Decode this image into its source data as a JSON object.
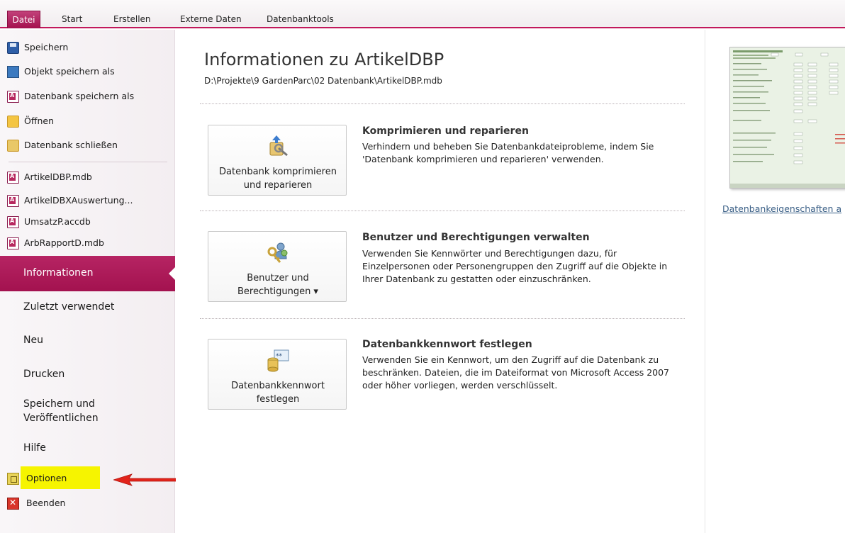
{
  "ribbon": {
    "tabs": [
      "Datei",
      "Start",
      "Erstellen",
      "Externe Daten",
      "Datenbanktools"
    ]
  },
  "backstage": {
    "quick_commands": [
      {
        "label": "Speichern",
        "icon": "save-icon"
      },
      {
        "label": "Objekt speichern als",
        "icon": "save-object-as-icon"
      },
      {
        "label": "Datenbank speichern als",
        "icon": "save-database-as-icon"
      },
      {
        "label": "Öffnen",
        "icon": "open-folder-icon"
      },
      {
        "label": "Datenbank schließen",
        "icon": "close-database-icon"
      }
    ],
    "recent_files": [
      "ArtikelDBP.mdb",
      "ArtikelDBXAuswertung...",
      "UmsatzP.accdb",
      "ArbRapportD.mdb"
    ],
    "nav": {
      "informationen": "Informationen",
      "zuletzt": "Zuletzt verwendet",
      "neu": "Neu",
      "drucken": "Drucken",
      "speichern_line1": "Speichern und",
      "speichern_line2": "Veröffentlichen",
      "hilfe": "Hilfe"
    },
    "bottom_commands": {
      "optionen": "Optionen",
      "beenden": "Beenden"
    }
  },
  "info": {
    "title": "Informationen zu ArtikelDBP",
    "path": "D:\\Projekte\\9 GardenParc\\02 Datenbank\\ArtikelDBP.mdb",
    "sections": [
      {
        "button_line1": "Datenbank komprimieren",
        "button_line2": "und reparieren",
        "heading": "Komprimieren und reparieren",
        "description": "Verhindern und beheben Sie Datenbankdateiprobleme, indem Sie 'Datenbank komprimieren und reparieren' verwenden."
      },
      {
        "button_line1": "Benutzer und",
        "button_line2": "Berechtigungen ▾",
        "heading": "Benutzer und Berechtigungen verwalten",
        "description": "Verwenden Sie Kennwörter und Berechtigungen dazu, für Einzelpersonen oder Personengruppen den Zugriff auf die Objekte in Ihrer Datenbank zu gestatten oder einzuschränken."
      },
      {
        "button_line1": "Datenbankkennwort",
        "button_line2": "festlegen",
        "heading": "Datenbankkennwort festlegen",
        "description": "Verwenden Sie ein Kennwort, um den Zugriff auf die Datenbank zu beschränken. Dateien, die im Dateiformat von Microsoft Access 2007 oder höher vorliegen, werden verschlüsselt."
      }
    ]
  },
  "right_pane": {
    "properties_link": "Datenbankeigenschaften a"
  },
  "colors": {
    "accent": "#a3124f",
    "highlight": "#f6f400",
    "arrow": "#e2231a"
  }
}
